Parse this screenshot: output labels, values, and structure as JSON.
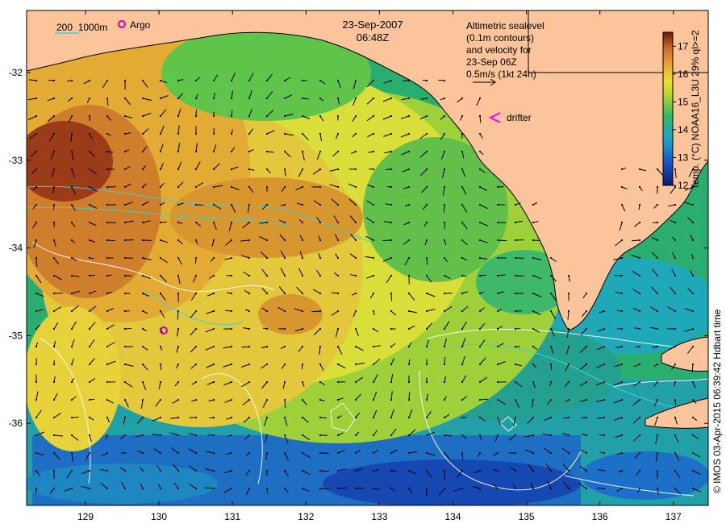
{
  "header": {
    "date": "23-Sep-2007",
    "time": "06:48Z"
  },
  "legend": {
    "depth_contours": "200  1000m",
    "argo": "Argo",
    "drifter": "drifter",
    "altimetry_lines": [
      "Altimetric sealevel",
      "(0.1m contours)",
      "and velocity for",
      "23-Sep 06Z",
      "0.5m/s (1kt 24h)"
    ]
  },
  "colorbar": {
    "label": "Temp. (°C) NOAA16_L3U 29% ql>=2",
    "ticks": [
      "12",
      "13",
      "14",
      "15",
      "16",
      "17"
    ],
    "min": 12,
    "max": 17.5
  },
  "axes": {
    "lon_ticks": [
      "129",
      "130",
      "131",
      "132",
      "133",
      "134",
      "135",
      "136",
      "137"
    ],
    "lat_ticks": [
      "-32",
      "-33",
      "-34",
      "-35",
      "-36"
    ]
  },
  "credit": "© IMOS 03-Apr-2015 06:39:42 Hdbart time",
  "colors": {
    "land": "#fbc49a",
    "argo": "#c000c0",
    "drifter": "#ff00ff",
    "isobath": "#3fd0d0",
    "sealevel_contour": "#ffffff",
    "vector": "#000000"
  }
}
